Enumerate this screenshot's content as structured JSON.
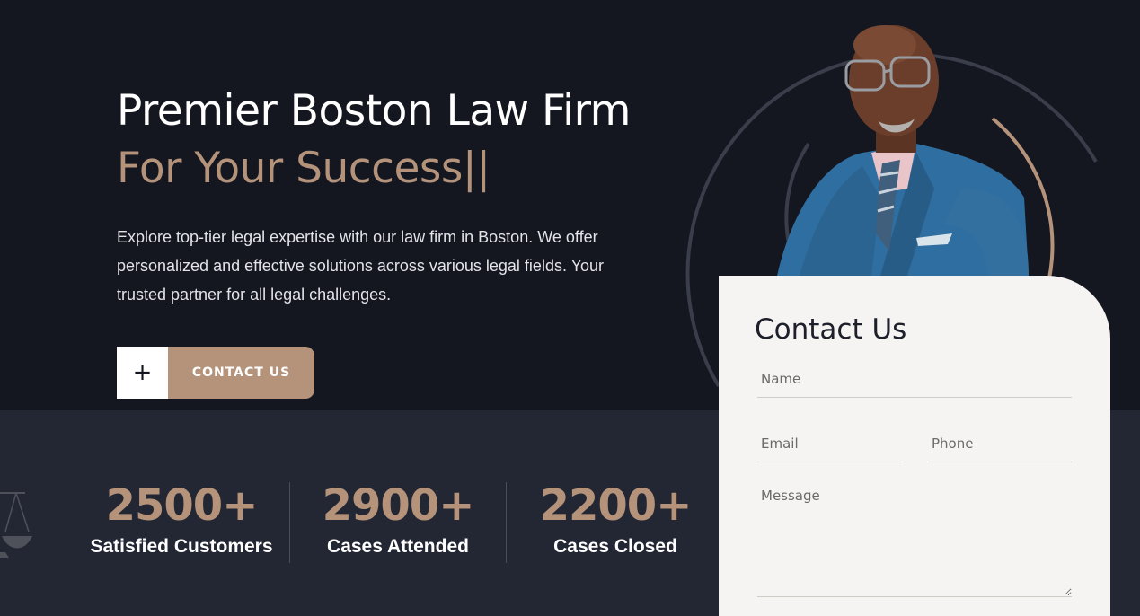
{
  "hero": {
    "title_line1": "Premier Boston Law Firm",
    "title_line2": "For Your Success",
    "caret": "||",
    "description": "Explore top-tier legal expertise with our law firm in Boston. We offer personalized and effective solutions across various legal fields. Your trusted partner for all legal challenges.",
    "cta_icon": "+",
    "cta_label": "CONTACT US"
  },
  "stats": [
    {
      "value": "2500+",
      "label": "Satisfied Customers"
    },
    {
      "value": "2900+",
      "label": "Cases Attended"
    },
    {
      "value": "2200+",
      "label": "Cases Closed"
    }
  ],
  "contact_form": {
    "title": "Contact Us",
    "name_placeholder": "Name",
    "email_placeholder": "Email",
    "phone_placeholder": "Phone",
    "message_placeholder": "Message"
  },
  "colors": {
    "background": "#141620",
    "stats_background": "#232633",
    "accent": "#b4937a",
    "form_background": "#f6f4f2"
  },
  "icons": {
    "cta": "plus-icon",
    "stats_logo": "scales-of-justice-icon"
  }
}
